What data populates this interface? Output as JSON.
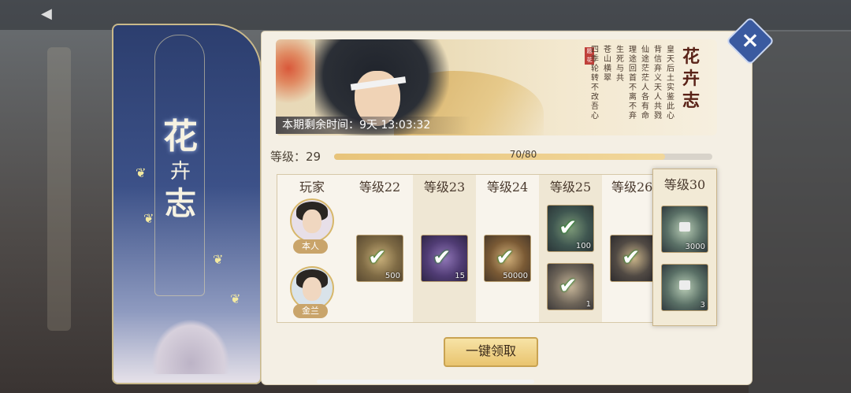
{
  "banner": {
    "title_chars": [
      "花",
      "卉",
      "志"
    ]
  },
  "close_label": "×",
  "hero": {
    "timer_label": "本期剩余时间：",
    "timer_value": "9天 13:03:32",
    "title_chars": [
      "花",
      "卉",
      "志"
    ],
    "seal_text": "题花",
    "poem_columns": [
      "皇天后土实鉴此心",
      "背信弃义天人共戮",
      "仙途茫茫人各有命",
      "理途回首不离不弃",
      "生死与共",
      "苍山横翠",
      "四季轮转不改吾心"
    ]
  },
  "level": {
    "label": "等级：",
    "value": "29",
    "progress_text": "70/80",
    "progress_fraction": 0.875
  },
  "table": {
    "player_header": "玩家",
    "players": [
      {
        "name": "本人"
      },
      {
        "name": "金兰"
      }
    ],
    "columns": [
      {
        "header": "等级22",
        "items": [
          {
            "icon": "bag-icon",
            "qty": "500",
            "claimed": true
          }
        ]
      },
      {
        "header": "等级23",
        "items": [
          {
            "icon": "puzzle-piece-icon",
            "qty": "15",
            "claimed": true
          }
        ]
      },
      {
        "header": "等级24",
        "items": [
          {
            "icon": "coin-icon",
            "qty": "50000",
            "claimed": true
          }
        ]
      },
      {
        "header": "等级25",
        "items": [
          {
            "icon": "pouch-icon",
            "qty": "100",
            "claimed": true
          },
          {
            "icon": "scroll-icon",
            "qty": "1",
            "claimed": true
          }
        ]
      },
      {
        "header": "等级26",
        "items": [
          {
            "icon": "scroll-icon",
            "qty": "",
            "claimed": true
          }
        ]
      }
    ],
    "highlight_column": {
      "header": "等级30",
      "items": [
        {
          "icon": "money-stack-icon",
          "qty": "3000",
          "locked": true
        },
        {
          "icon": "money-stack-icon",
          "qty": "3",
          "locked": true
        }
      ]
    }
  },
  "claim_all_label": "一键领取",
  "colors": {
    "accent": "#e9c46f",
    "banner": "#3c5188",
    "panel": "#f4efe4"
  }
}
